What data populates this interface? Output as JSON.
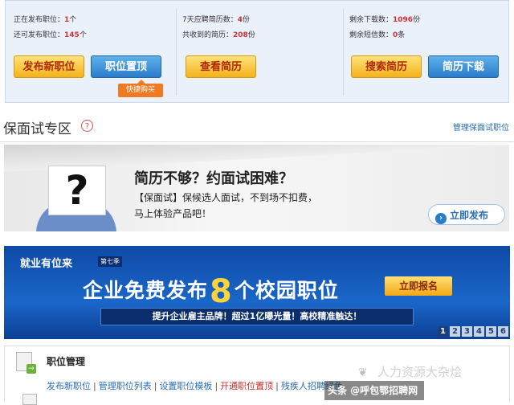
{
  "stats": {
    "col1": [
      {
        "label": "正在发布职位：",
        "value": "1",
        "unit": "个"
      },
      {
        "label": "还可发布职位：",
        "value": "145",
        "unit": "个"
      }
    ],
    "col2": [
      {
        "label": "7天应聘简历数：",
        "value": "4",
        "unit": "份"
      },
      {
        "label": "共收到的简历：",
        "value": "208",
        "unit": "份"
      }
    ],
    "col3": [
      {
        "label": "剩余下载数：",
        "value": "1096",
        "unit": "份"
      },
      {
        "label": "剩余短信数：",
        "value": "0",
        "unit": "条"
      }
    ],
    "buttons": {
      "publish_job": "发布新职位",
      "top_job": "职位置顶",
      "view_resume": "查看简历",
      "search_resume": "搜索简历",
      "download_resume": "简历下载"
    },
    "quick_buy": "快捷购买"
  },
  "section": {
    "title": "保面试专区",
    "help": "?",
    "manage_link": "管理保面试职位"
  },
  "promo": {
    "headline": "简历不够？约面试困难？",
    "desc_line1": "【保面试】保候选人面试，不到场不扣费，",
    "desc_line2": "马上体验产品吧！",
    "publish_button": "立即发布",
    "sign_text": "?"
  },
  "campus": {
    "brand": "就业有位来",
    "period": "第七季",
    "main_prefix": "企业免费发布",
    "main_number": "8",
    "main_suffix": "个校园职位",
    "signup": "立即报名",
    "tagline": "提升企业雇主品牌！超过1亿曝光量！高校精准触达！",
    "pages": [
      "1",
      "2",
      "3",
      "4",
      "5",
      "6"
    ],
    "active_page": "1"
  },
  "job_mgmt": {
    "title": "职位管理",
    "links": [
      "发布新职位",
      "管理职位列表",
      "设置职位模板",
      "开通职位置顶",
      "残疾人招聘绿色"
    ]
  },
  "watermark": {
    "text": "头条 @呼包鄂招聘网",
    "faded": "人力资源大杂烩"
  },
  "colors": {
    "accent_blue": "#2a7ccb",
    "accent_orange": "#f3b21c",
    "hot_red": "#d42a2a"
  }
}
